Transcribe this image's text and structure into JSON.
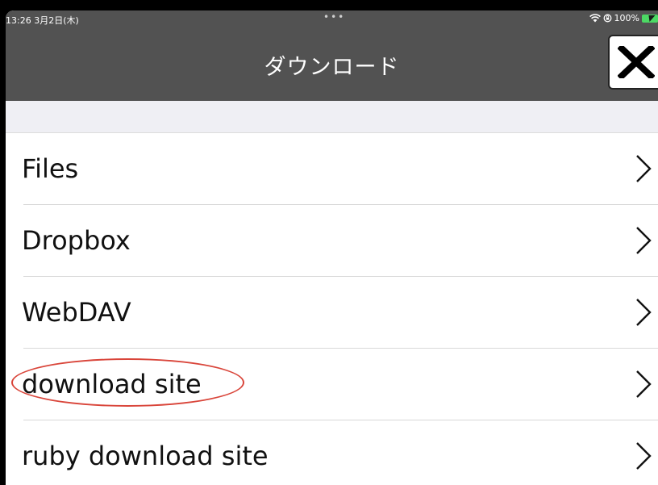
{
  "status_bar": {
    "time_date": "13:26  3月2日(木)",
    "battery_percent": "100%"
  },
  "nav": {
    "title": "ダウンロード",
    "close_icon": "x-icon"
  },
  "list": {
    "items": [
      {
        "label": "Files"
      },
      {
        "label": "Dropbox"
      },
      {
        "label": "WebDAV"
      },
      {
        "label": "download site"
      },
      {
        "label": "ruby download site"
      }
    ]
  },
  "colors": {
    "nav_background": "#525252",
    "highlight": "#d9453a",
    "battery": "#4cd964"
  }
}
